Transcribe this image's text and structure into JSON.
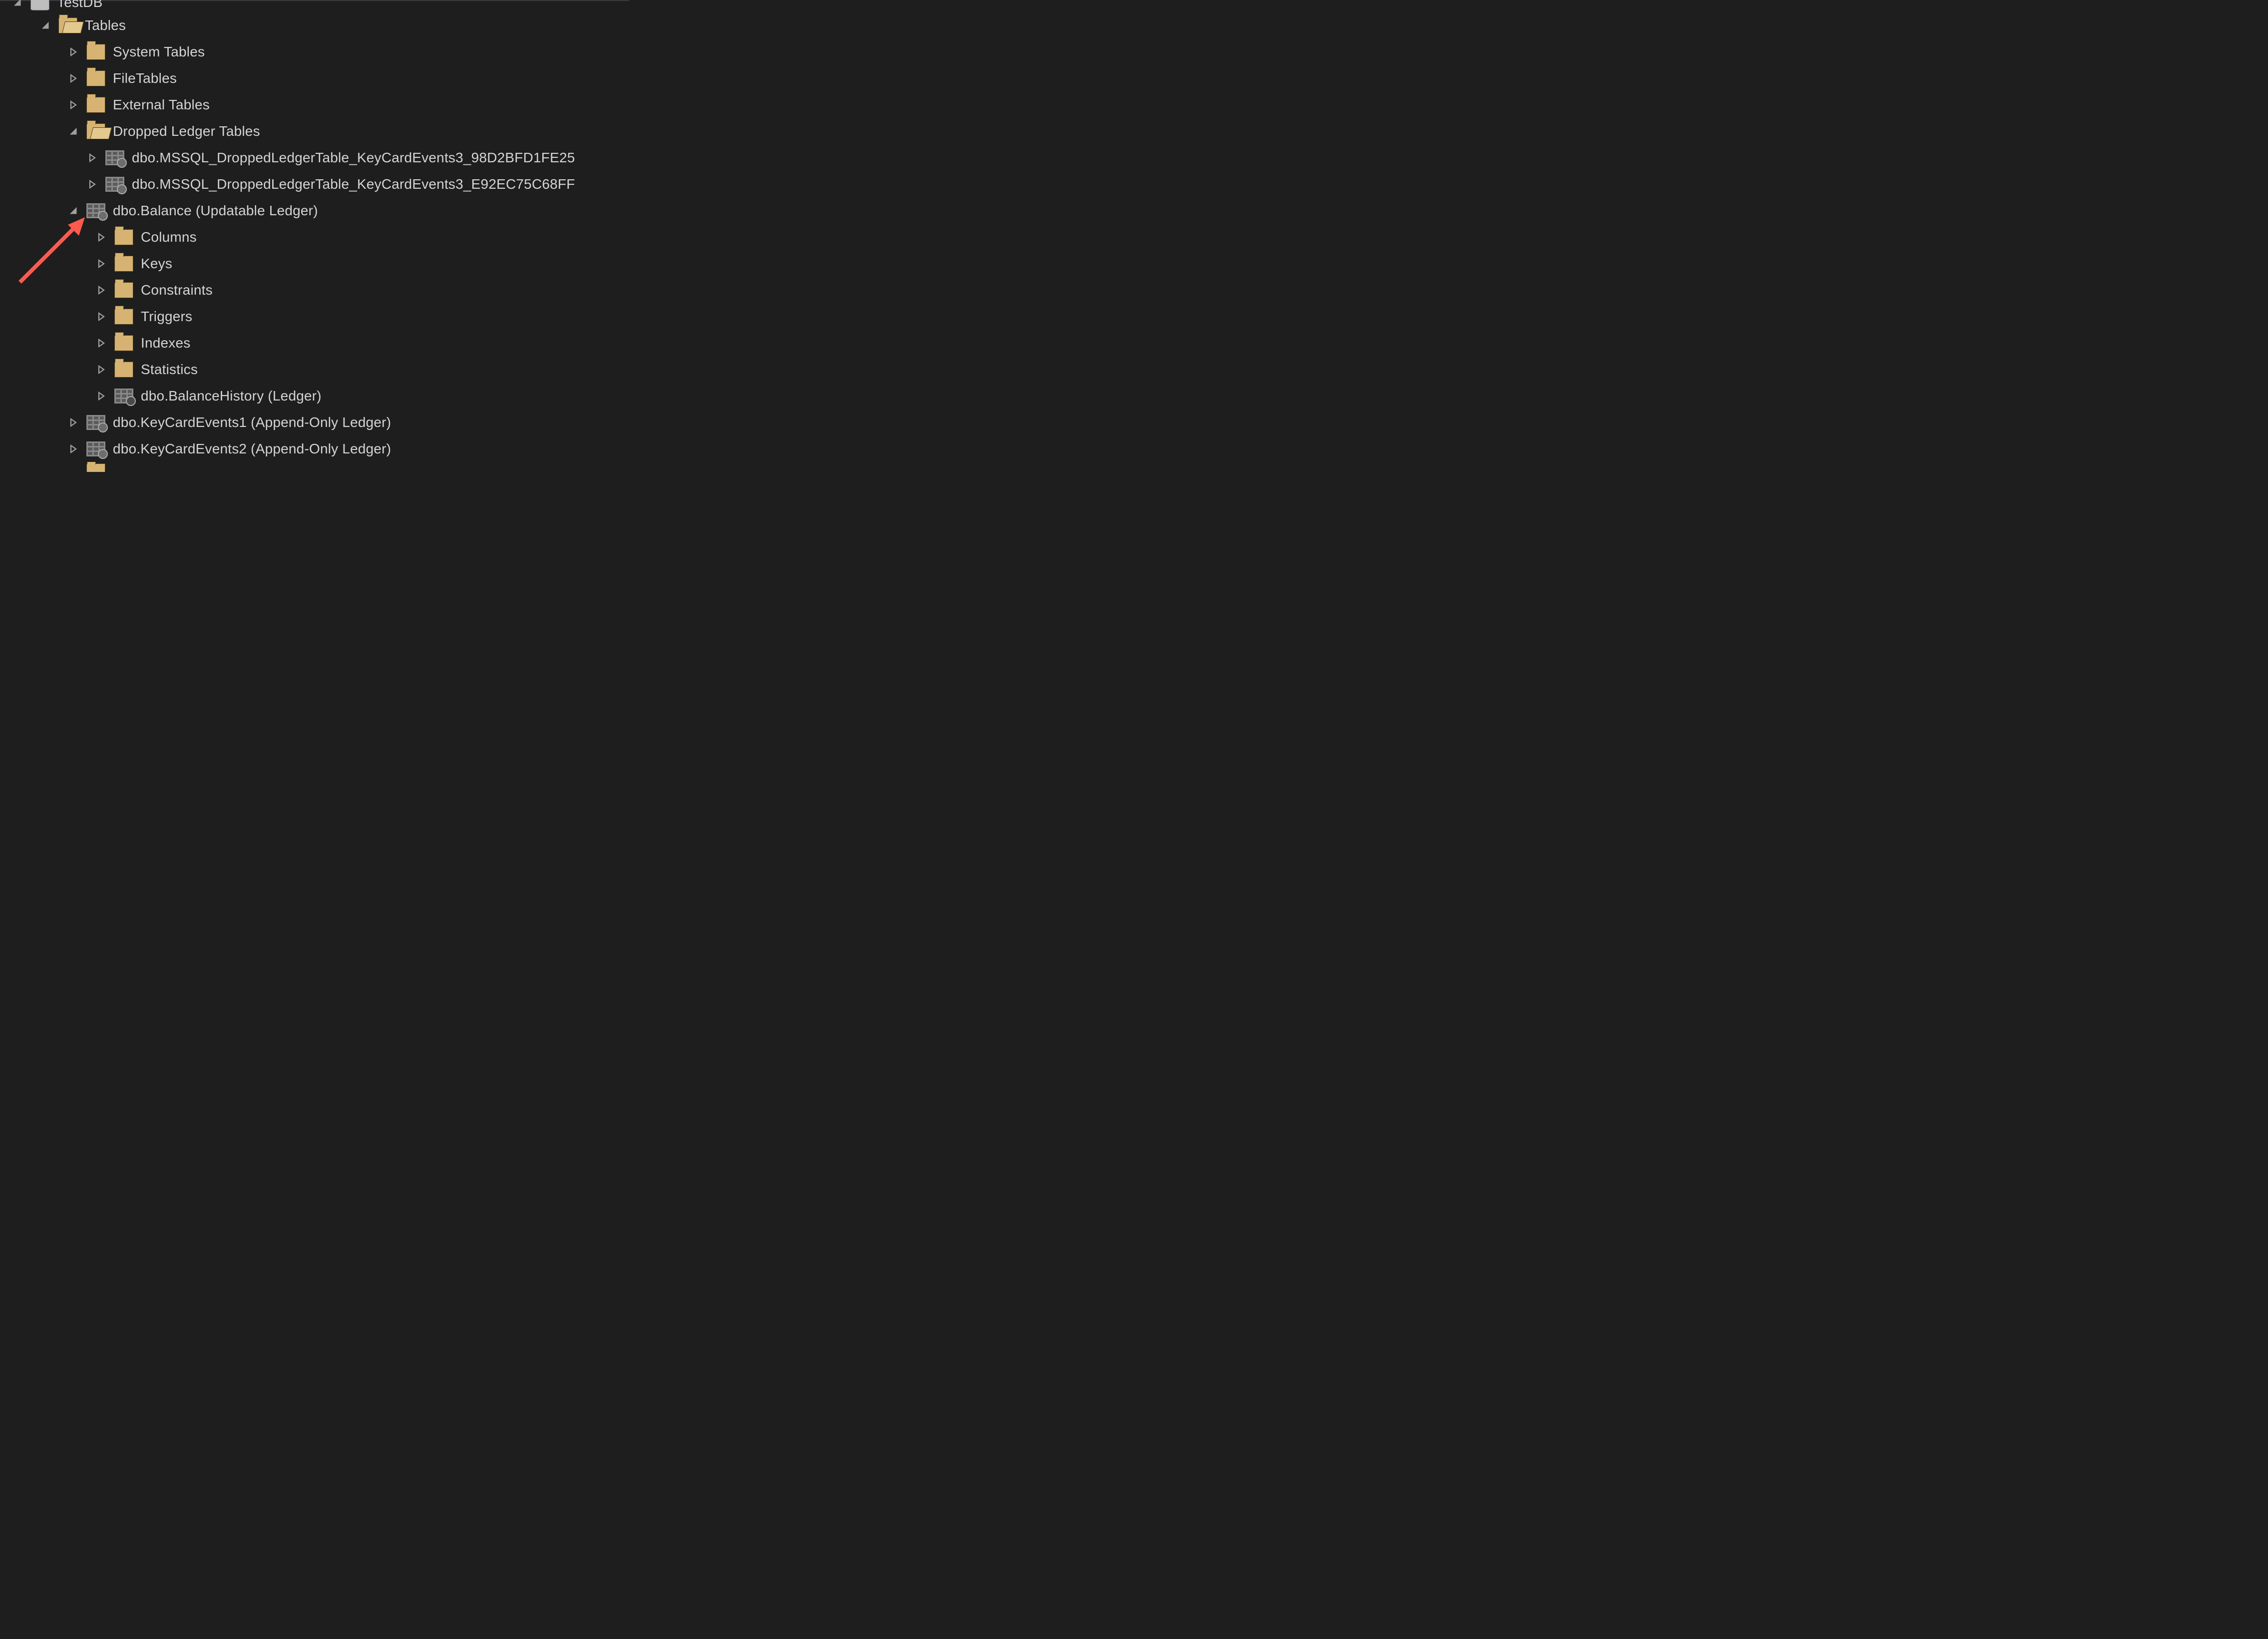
{
  "tree": {
    "db": {
      "label": "TestDB"
    },
    "tables": {
      "label": "Tables"
    },
    "system_tables": {
      "label": "System Tables"
    },
    "file_tables": {
      "label": "FileTables"
    },
    "external_tables": {
      "label": "External Tables"
    },
    "dropped_ledger": {
      "label": "Dropped Ledger Tables"
    },
    "dropped_1": {
      "label": "dbo.MSSQL_DroppedLedgerTable_KeyCardEvents3_98D2BFD1FE25"
    },
    "dropped_2": {
      "label": "dbo.MSSQL_DroppedLedgerTable_KeyCardEvents3_E92EC75C68FF"
    },
    "balance": {
      "label": "dbo.Balance (Updatable Ledger)"
    },
    "columns": {
      "label": "Columns"
    },
    "keys": {
      "label": "Keys"
    },
    "constraints": {
      "label": "Constraints"
    },
    "triggers": {
      "label": "Triggers"
    },
    "indexes": {
      "label": "Indexes"
    },
    "statistics": {
      "label": "Statistics"
    },
    "balance_history": {
      "label": "dbo.BalanceHistory (Ledger)"
    },
    "keycard1": {
      "label": "dbo.KeyCardEvents1 (Append-Only Ledger)"
    },
    "keycard2": {
      "label": "dbo.KeyCardEvents2 (Append-Only Ledger)"
    }
  },
  "colors": {
    "bg": "#1e1e1e",
    "text": "#d4d4d4",
    "folder": "#d6b372",
    "arrow_annotation": "#ff5a4d"
  }
}
